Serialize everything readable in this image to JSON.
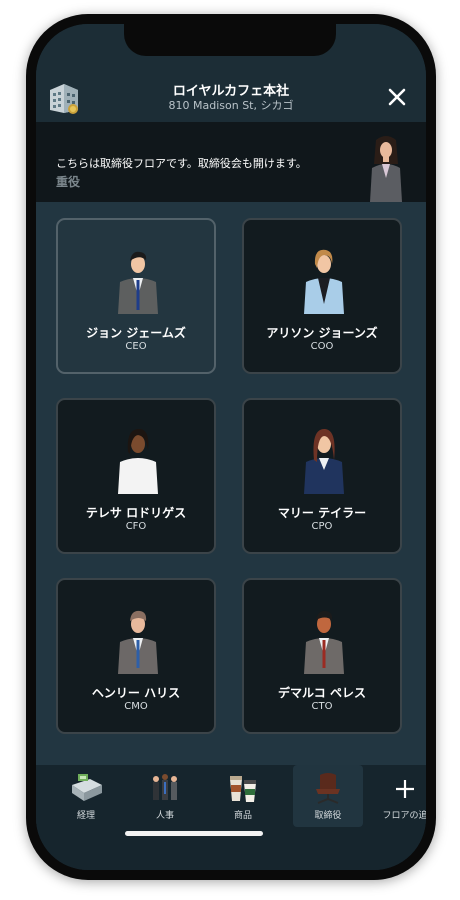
{
  "header": {
    "title": "ロイヤルカフェ本社",
    "subtitle": "810 Madison St, シカゴ",
    "logo_icon": "office-building-icon",
    "close_icon": "close-icon"
  },
  "banner": {
    "message": "こちらは取締役フロアです。取締役会も開けます。",
    "sub": "重役"
  },
  "executives": [
    {
      "name": "ジョン ジェームズ",
      "role": "CEO"
    },
    {
      "name": "アリソン ジョーンズ",
      "role": "COO"
    },
    {
      "name": "テレサ ロドリゲス",
      "role": "CFO"
    },
    {
      "name": "マリー テイラー",
      "role": "CPO"
    },
    {
      "name": "ヘンリー ハリス",
      "role": "CMO"
    },
    {
      "name": "デマルコ ペレス",
      "role": "CTO"
    }
  ],
  "tabs": [
    {
      "label": "経理",
      "icon": "cash-register-icon"
    },
    {
      "label": "人事",
      "icon": "people-icon"
    },
    {
      "label": "商品",
      "icon": "coffee-cups-icon"
    },
    {
      "label": "取締役",
      "icon": "office-chair-icon",
      "active": true
    },
    {
      "label": "フロアの追",
      "icon": "plus-icon"
    }
  ],
  "colors": {
    "background": "#1b2c35",
    "card": "#121b1f",
    "card_selected": "#233640",
    "text": "#ffffff"
  }
}
